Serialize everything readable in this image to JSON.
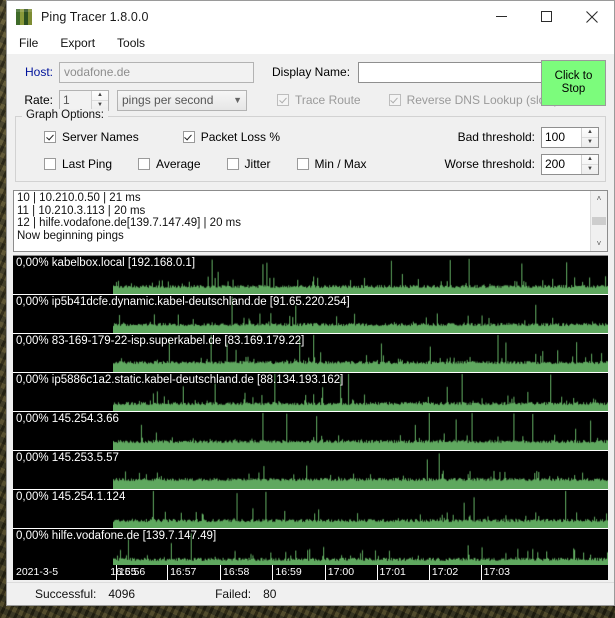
{
  "window": {
    "title": "Ping Tracer 1.8.0.0",
    "icon": "app-icon",
    "minimize": "─",
    "maximize": "□",
    "close": "✕"
  },
  "menu": [
    "File",
    "Export",
    "Tools"
  ],
  "form": {
    "host_label": "Host:",
    "host_value": "vodafone.de",
    "display_name_label": "Display Name:",
    "display_name_value": "",
    "rate_label": "Rate:",
    "rate_value": "1",
    "rate_unit": "pings per second",
    "trace_route": "Trace Route",
    "reverse_dns": "Reverse DNS Lookup (slow)",
    "action_button_line1": "Click to",
    "action_button_line2": "Stop",
    "action_button_color": "#7cfc7c"
  },
  "graph_options": {
    "title": "Graph Options:",
    "checkboxes": [
      {
        "label": "Server Names",
        "checked": true
      },
      {
        "label": "Packet Loss %",
        "checked": true
      },
      {
        "label": "Last Ping",
        "checked": false
      },
      {
        "label": "Average",
        "checked": false
      },
      {
        "label": "Jitter",
        "checked": false
      },
      {
        "label": "Min / Max",
        "checked": false
      }
    ],
    "bad_threshold_label": "Bad threshold:",
    "bad_threshold_value": "100",
    "worse_threshold_label": "Worse threshold:",
    "worse_threshold_value": "200"
  },
  "log": {
    "lines": [
      "10 | 10.210.0.50 | 21 ms",
      "11 | 10.210.3.113 | 20 ms",
      "12 | hilfe.vodafone.de[139.7.147.49] | 20 ms",
      "Now beginning pings"
    ],
    "scroll_up_icon": "˄",
    "scroll_down_icon": "˅"
  },
  "graphs": {
    "trace_color": "#5fa85f",
    "background_color": "#000000",
    "rows": [
      {
        "loss": "0,00%",
        "host": "kabelbox.local [192.168.0.1]"
      },
      {
        "loss": "0,00%",
        "host": "ip5b41dcfe.dynamic.kabel-deutschland.de [91.65.220.254]"
      },
      {
        "loss": "0,00%",
        "host": "83-169-179-22-isp.superkabel.de [83.169.179.22]"
      },
      {
        "loss": "0,00%",
        "host": "ip5886c1a2.static.kabel-deutschland.de [88.134.193.162]"
      },
      {
        "loss": "0,00%",
        "host": "145.254.3.66"
      },
      {
        "loss": "0,00%",
        "host": "145.253.5.57"
      },
      {
        "loss": "0,00%",
        "host": "145.254.1.124"
      },
      {
        "loss": "0,00%",
        "host": "hilfe.vodafone.de [139.7.147.49]"
      }
    ]
  },
  "timeline": {
    "date": "2021-3-5",
    "ticks": [
      "16:55",
      "16:56",
      "16:57",
      "16:58",
      "16:59",
      "17:00",
      "17:01",
      "17:02",
      "17:03"
    ]
  },
  "status": {
    "successful_label": "Successful:",
    "successful_value": "4096",
    "failed_label": "Failed:",
    "failed_value": "80"
  }
}
